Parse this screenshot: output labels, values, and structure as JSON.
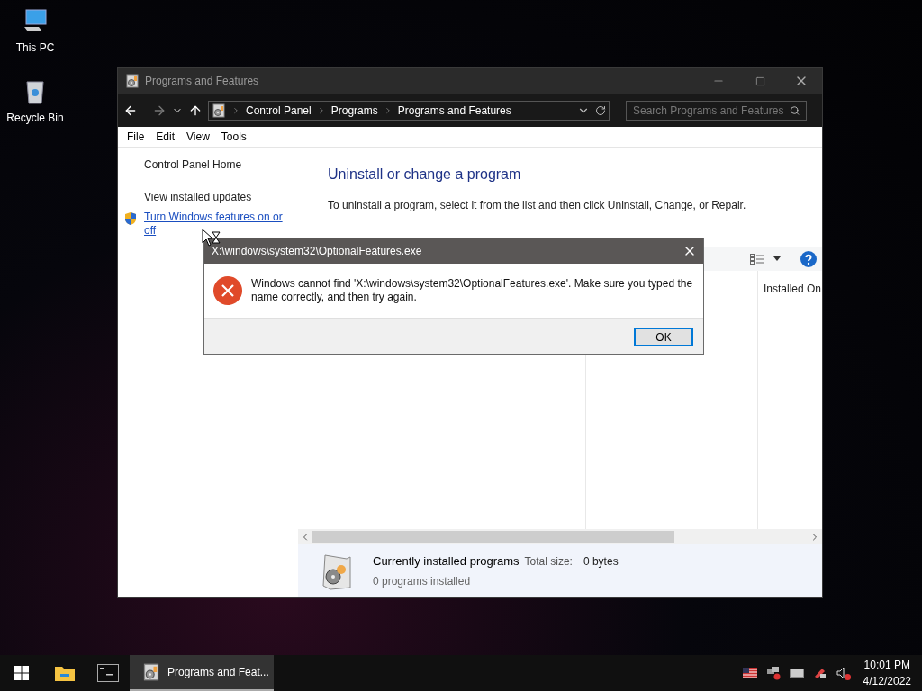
{
  "desktop_icons": [
    {
      "kind": "pc",
      "label": "This PC"
    },
    {
      "kind": "bin",
      "label": "Recycle Bin"
    }
  ],
  "window": {
    "title": "Programs and Features",
    "breadcrumb": [
      "Control Panel",
      "Programs",
      "Programs and Features"
    ],
    "search": {
      "placeholder": "Search Programs and Features"
    },
    "menu": [
      "File",
      "Edit",
      "View",
      "Tools"
    ],
    "sidebar": [
      {
        "label": "Control Panel Home",
        "kind": "plain"
      },
      {
        "label": "View installed updates",
        "kind": "plain"
      },
      {
        "label": "Turn Windows features on or off",
        "kind": "shield-link"
      }
    ],
    "heading": "Uninstall or change a program",
    "instructions": "To uninstall a program, select it from the list and then click Uninstall, Change, or Repair.",
    "columns": [
      "Installed On"
    ],
    "details": {
      "title": "Currently installed programs",
      "size_label": "Total size:",
      "size_value": "0 bytes",
      "count": "0 programs installed"
    }
  },
  "dialog": {
    "title": "X:\\windows\\system32\\OptionalFeatures.exe",
    "message": "Windows cannot find 'X:\\windows\\system32\\OptionalFeatures.exe'. Make sure you typed the name correctly, and then try again.",
    "buttons": [
      "OK"
    ]
  },
  "taskbar": {
    "items": [
      {
        "kind": "start",
        "selected": false
      },
      {
        "kind": "explorer",
        "selected": false
      },
      {
        "kind": "cmd",
        "selected": false
      },
      {
        "kind": "programs",
        "label": "Programs and Feat...",
        "selected": true
      }
    ],
    "time": "10:01 PM",
    "date": "4/12/2022"
  }
}
